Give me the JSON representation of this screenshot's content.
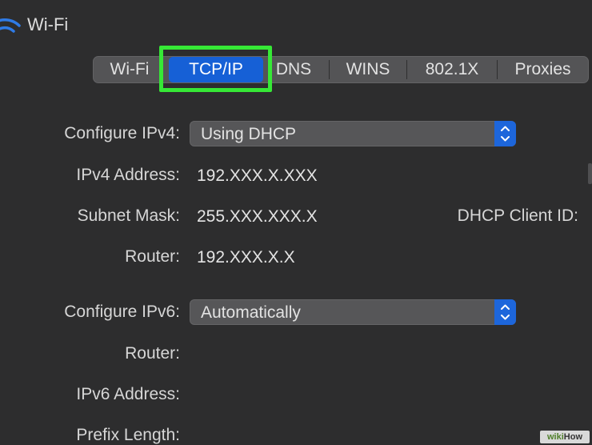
{
  "window": {
    "title": "Wi-Fi"
  },
  "tabs": [
    {
      "label": "Wi-Fi",
      "active": false
    },
    {
      "label": "TCP/IP",
      "active": true
    },
    {
      "label": "DNS",
      "active": false
    },
    {
      "label": "WINS",
      "active": false
    },
    {
      "label": "802.1X",
      "active": false
    },
    {
      "label": "Proxies",
      "active": false
    }
  ],
  "ipv4": {
    "configure_label": "Configure IPv4:",
    "configure_value": "Using DHCP",
    "address_label": "IPv4 Address:",
    "address_value": "192.XXX.X.XXX",
    "subnet_label": "Subnet Mask:",
    "subnet_value": "255.XXX.XXX.X",
    "router_label": "Router:",
    "router_value": "192.XXX.X.X",
    "dhcp_client_label": "DHCP Client ID:"
  },
  "ipv6": {
    "configure_label": "Configure IPv6:",
    "configure_value": "Automatically",
    "router_label": "Router:",
    "address_label": "IPv6 Address:",
    "prefix_label": "Prefix Length:"
  },
  "watermark": {
    "wiki": "wiki",
    "how": "How"
  },
  "colors": {
    "accent": "#1660d6",
    "highlight": "#36e836",
    "background": "#2d2d2e"
  }
}
